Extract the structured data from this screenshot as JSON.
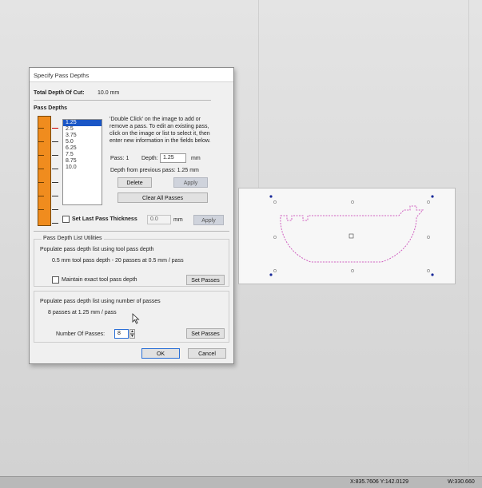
{
  "dialog": {
    "title": "Specify Pass Depths",
    "total_depth_label": "Total Depth Of Cut:",
    "total_depth_value": "10.0 mm",
    "section_pass_depths": "Pass Depths",
    "instructions": [
      "'Double Click' on the image to add or",
      "remove a pass. To edit an existing pass,",
      "click on the image or list to select it, then",
      "enter new information in the fields below."
    ],
    "passes": [
      "1.25",
      "2.5",
      "3.75",
      "5.0",
      "6.25",
      "7.5",
      "8.75",
      "10.0"
    ],
    "selected_pass_index": 0,
    "pass_label": "Pass: 1",
    "depth_label": "Depth:",
    "depth_value": "1.25",
    "depth_unit": "mm",
    "depth_from_previous": "Depth from previous pass:  1.25 mm",
    "delete_button": "Delete",
    "apply_button": "Apply",
    "clear_all_button": "Clear All Passes",
    "set_last_pass_label": "Set Last Pass Thickness",
    "last_pass_value": "0.0",
    "last_pass_unit": "mm",
    "last_pass_apply": "Apply",
    "utilities_title": "Pass Depth List Utilities",
    "populate_tool_label": "Populate pass depth list using tool pass depth",
    "populate_tool_summary": "0.5 mm tool pass depth - 20 passes at 0.5 mm / pass",
    "maintain_exact_label": "Maintain exact tool pass depth",
    "set_passes_button_1": "Set Passes",
    "populate_number_label": "Populate pass depth list using number of passes",
    "populate_number_summary": "8 passes at 1.25 mm / pass",
    "number_of_passes_label": "Number Of Passes:",
    "number_of_passes_value": "8",
    "set_passes_button_2": "Set Passes",
    "ok_button": "OK",
    "cancel_button": "Cancel"
  },
  "status_bar": {
    "coords": "X:835.7606 Y:142.0129",
    "width": "W:330.660"
  },
  "colors": {
    "ruler": "#f08c1e",
    "selection": "#1a56c6",
    "toolpath": "#d060c0",
    "handle": "#1a2a9a"
  },
  "icons": {
    "spin_up": "spin-up-icon",
    "spin_down": "spin-down-icon",
    "cursor": "mouse-cursor-icon"
  }
}
